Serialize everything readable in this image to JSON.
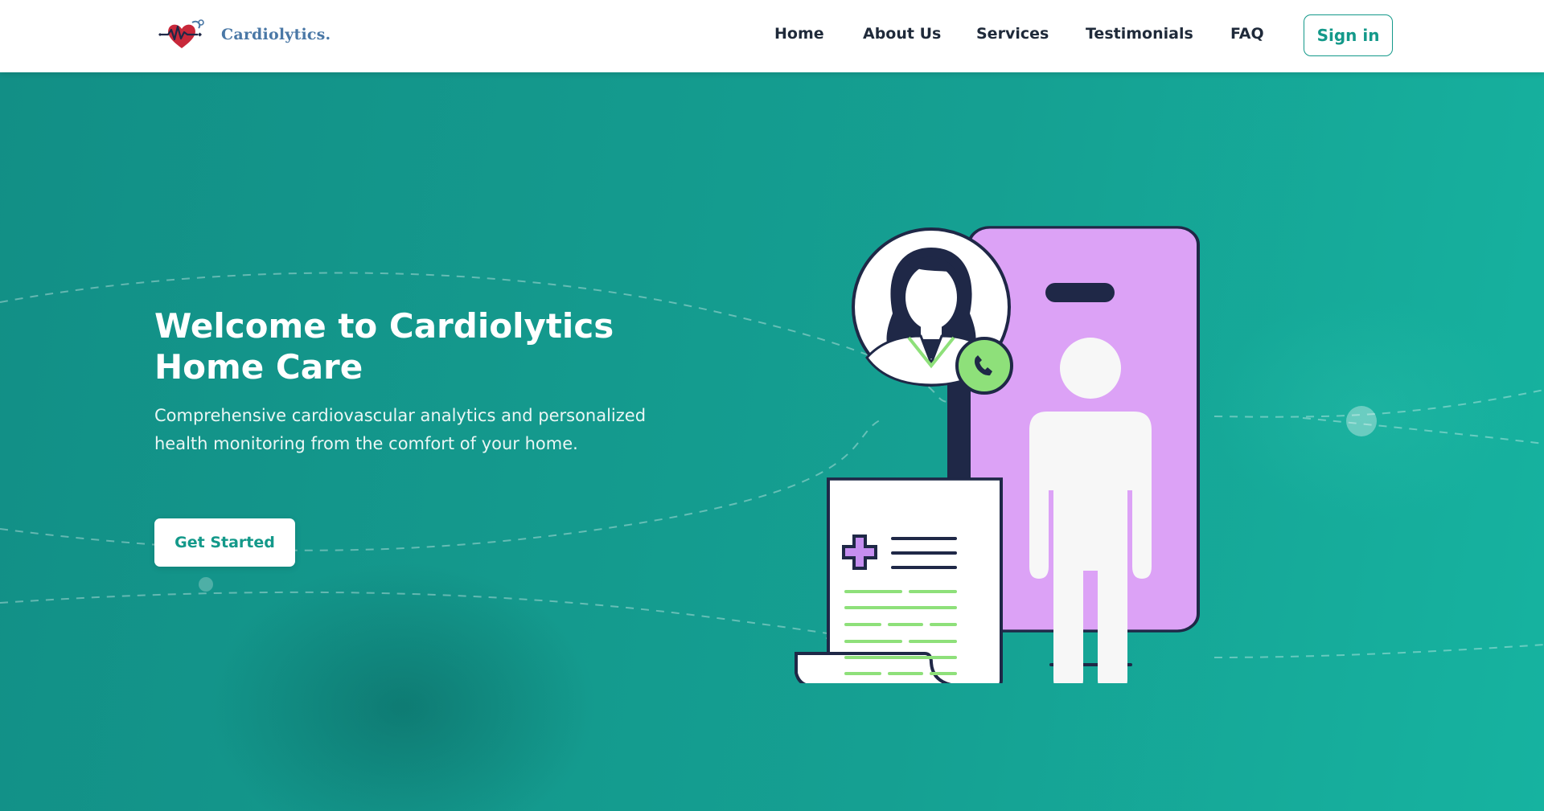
{
  "brand": {
    "name": "Cardiolytics.",
    "logo_color": "#4a78a6",
    "heart_color": "#c8283a"
  },
  "nav": {
    "items": [
      {
        "label": "Home"
      },
      {
        "label": "About Us"
      },
      {
        "label": "Services"
      },
      {
        "label": "Testimonials"
      },
      {
        "label": "FAQ"
      }
    ],
    "signin_label": "Sign in"
  },
  "hero": {
    "title": "Welcome to Cardiolytics Home Care",
    "subtitle": "Comprehensive cardiovascular analytics and personalized health monitoring from the comfort of your home.",
    "cta_label": "Get Started"
  },
  "colors": {
    "accent": "#14998a",
    "phone": "#dca2f6",
    "outline": "#1f2847",
    "call": "#8ee07a",
    "doc_lines": "#8ee07a",
    "cross": "#c58ef0"
  },
  "icons": {
    "doctor": "doctor-avatar-icon",
    "call": "phone-call-icon",
    "report": "medical-report-icon",
    "person": "person-silhouette-icon"
  }
}
